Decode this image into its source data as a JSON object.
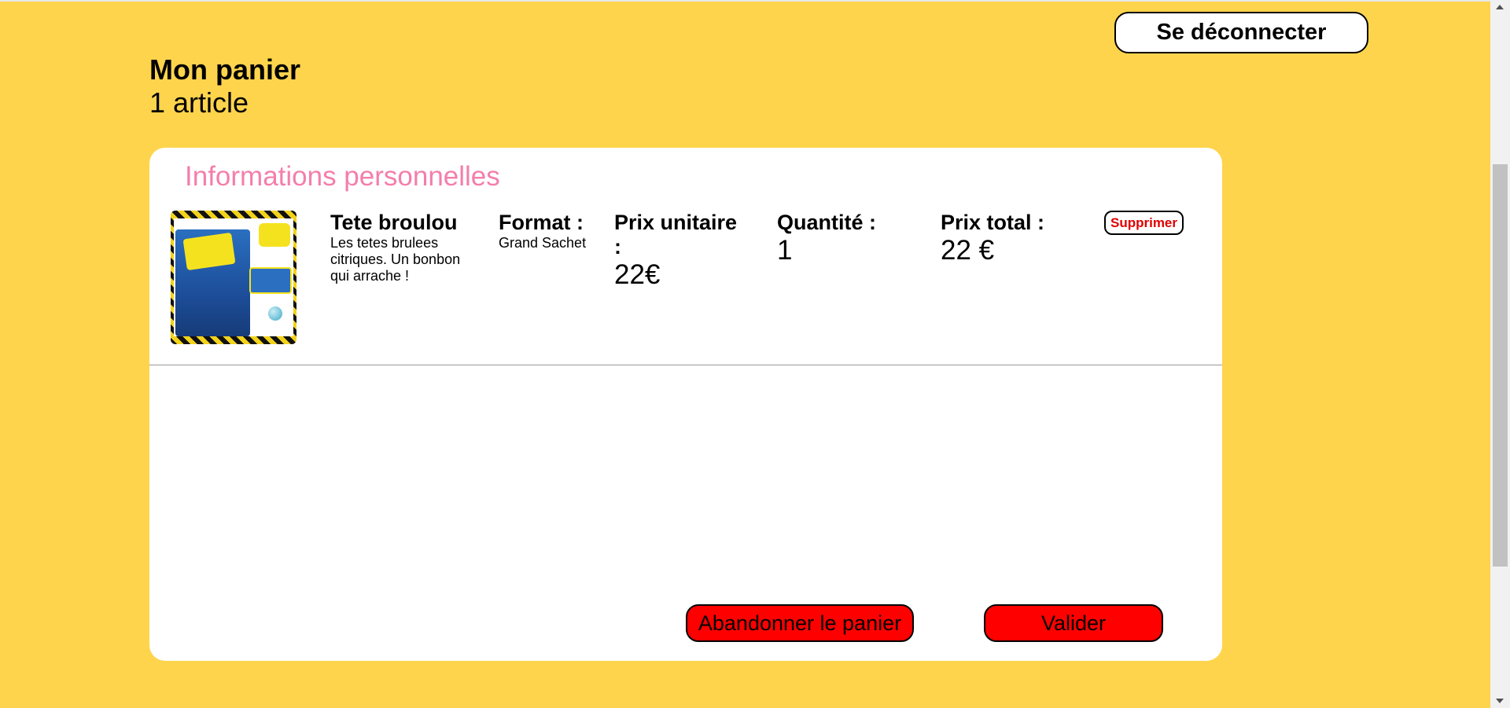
{
  "header": {
    "logout_label": "Se déconnecter",
    "title": "Mon panier",
    "count": "1 article"
  },
  "card": {
    "section_title": "Informations personnelles",
    "item": {
      "name": "Tete broulou",
      "description": "Les tetes brulees citriques. Un bonbon qui arrache !",
      "image_alt": "Têtes Brûlées",
      "format_label": "Format :",
      "format_value": "Grand Sachet",
      "unit_price_label": "Prix unitaire :",
      "unit_price_value": "22€",
      "quantity_label": "Quantité :",
      "quantity_value": "1",
      "total_label": "Prix total :",
      "total_value": "22 €",
      "delete_label": "Supprimer"
    },
    "actions": {
      "abandon_label": "Abandonner le panier",
      "validate_label": "Valider"
    }
  },
  "colors": {
    "background": "#FED44D",
    "section_title": "#F47EAC",
    "action_button": "#FF0000",
    "delete_text": "#E00000"
  }
}
